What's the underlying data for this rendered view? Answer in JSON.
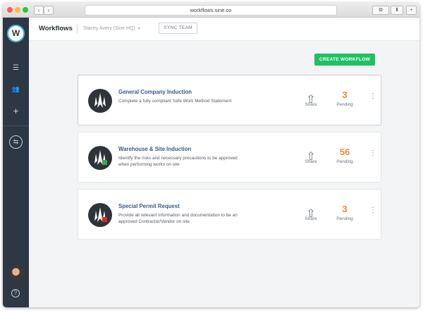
{
  "browser": {
    "url": "workflows.sine.co",
    "back_glyph": "‹",
    "forward_glyph": "›",
    "tabs_glyph": "⧉",
    "download_glyph": "⬇",
    "new_tab_glyph": "+"
  },
  "colors": {
    "sidebar": "#2e3744",
    "accent_green": "#20c063",
    "pending_orange": "#f08b30",
    "title_blue": "#3b5a86"
  },
  "sidebar": {
    "logo": "W",
    "items": [
      {
        "icon": "list-icon",
        "glyph": "☰"
      },
      {
        "icon": "team-icon",
        "glyph": "👥"
      },
      {
        "icon": "plus-icon",
        "glyph": "+"
      },
      {
        "icon": "sync-arrows-icon",
        "glyph": "⇆"
      }
    ],
    "help_glyph": "?"
  },
  "header": {
    "title": "Workflows",
    "organization": "Stacey Avery (Sine HQ)",
    "org_chevron": "▾",
    "sync_button": "SYNC TEAM"
  },
  "main": {
    "create_button": "CREATE WORKFLOW",
    "share_glyph": "⇧",
    "kebab_glyph": "⋮",
    "workflows": [
      {
        "title": "General Company Induction",
        "description": "Complete a fully compliant Safe Work Method Statement",
        "share_label": "Share",
        "count": "3",
        "count_label": "Pending",
        "badge_color": ""
      },
      {
        "title": "Warehouse & Site Induction",
        "description": "Identify the risks and necessary precautions to be approved when performing works on site",
        "share_label": "Share",
        "count": "56",
        "count_label": "Pending",
        "badge_color": "#2bb24c"
      },
      {
        "title": "Special Permit Request",
        "description": "Provide all relevant information and documentation to be an approved Contractor/Vendor on site",
        "share_label": "Share",
        "count": "3",
        "count_label": "Pending",
        "badge_color": "#e02424"
      }
    ]
  }
}
